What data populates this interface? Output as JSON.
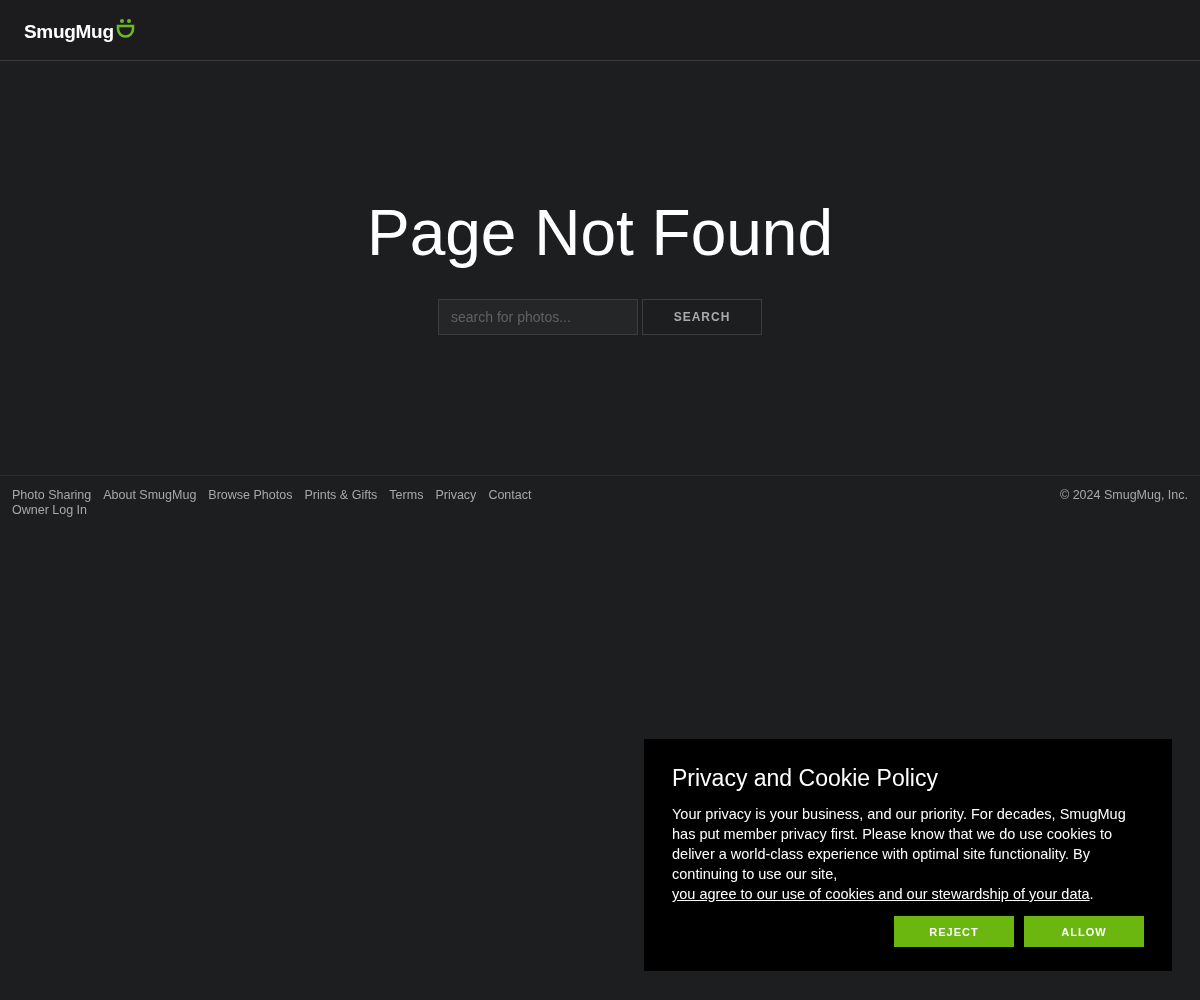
{
  "header": {
    "logo": "SmugMug"
  },
  "main": {
    "title": "Page Not Found",
    "search": {
      "placeholder": "search for photos...",
      "button": "SEARCH"
    }
  },
  "footer": {
    "links": [
      "Photo Sharing",
      "About SmugMug",
      "Browse Photos",
      "Prints & Gifts",
      "Terms",
      "Privacy",
      "Contact",
      "Owner Log In"
    ],
    "copyright": "© 2024 SmugMug, Inc."
  },
  "cookie_dialog": {
    "title": "Privacy and Cookie Policy",
    "body_before": "Your privacy is your business, and our priority. For decades, SmugMug has put member privacy first. Please know that we do use cookies to deliver a world-class experience with optimal site functionality. By continuing to use our site, ",
    "link": "you agree to our use of cookies and our stewardship of your data",
    "body_after": ".",
    "buttons": [
      "REJECT",
      "ALLOW"
    ]
  }
}
